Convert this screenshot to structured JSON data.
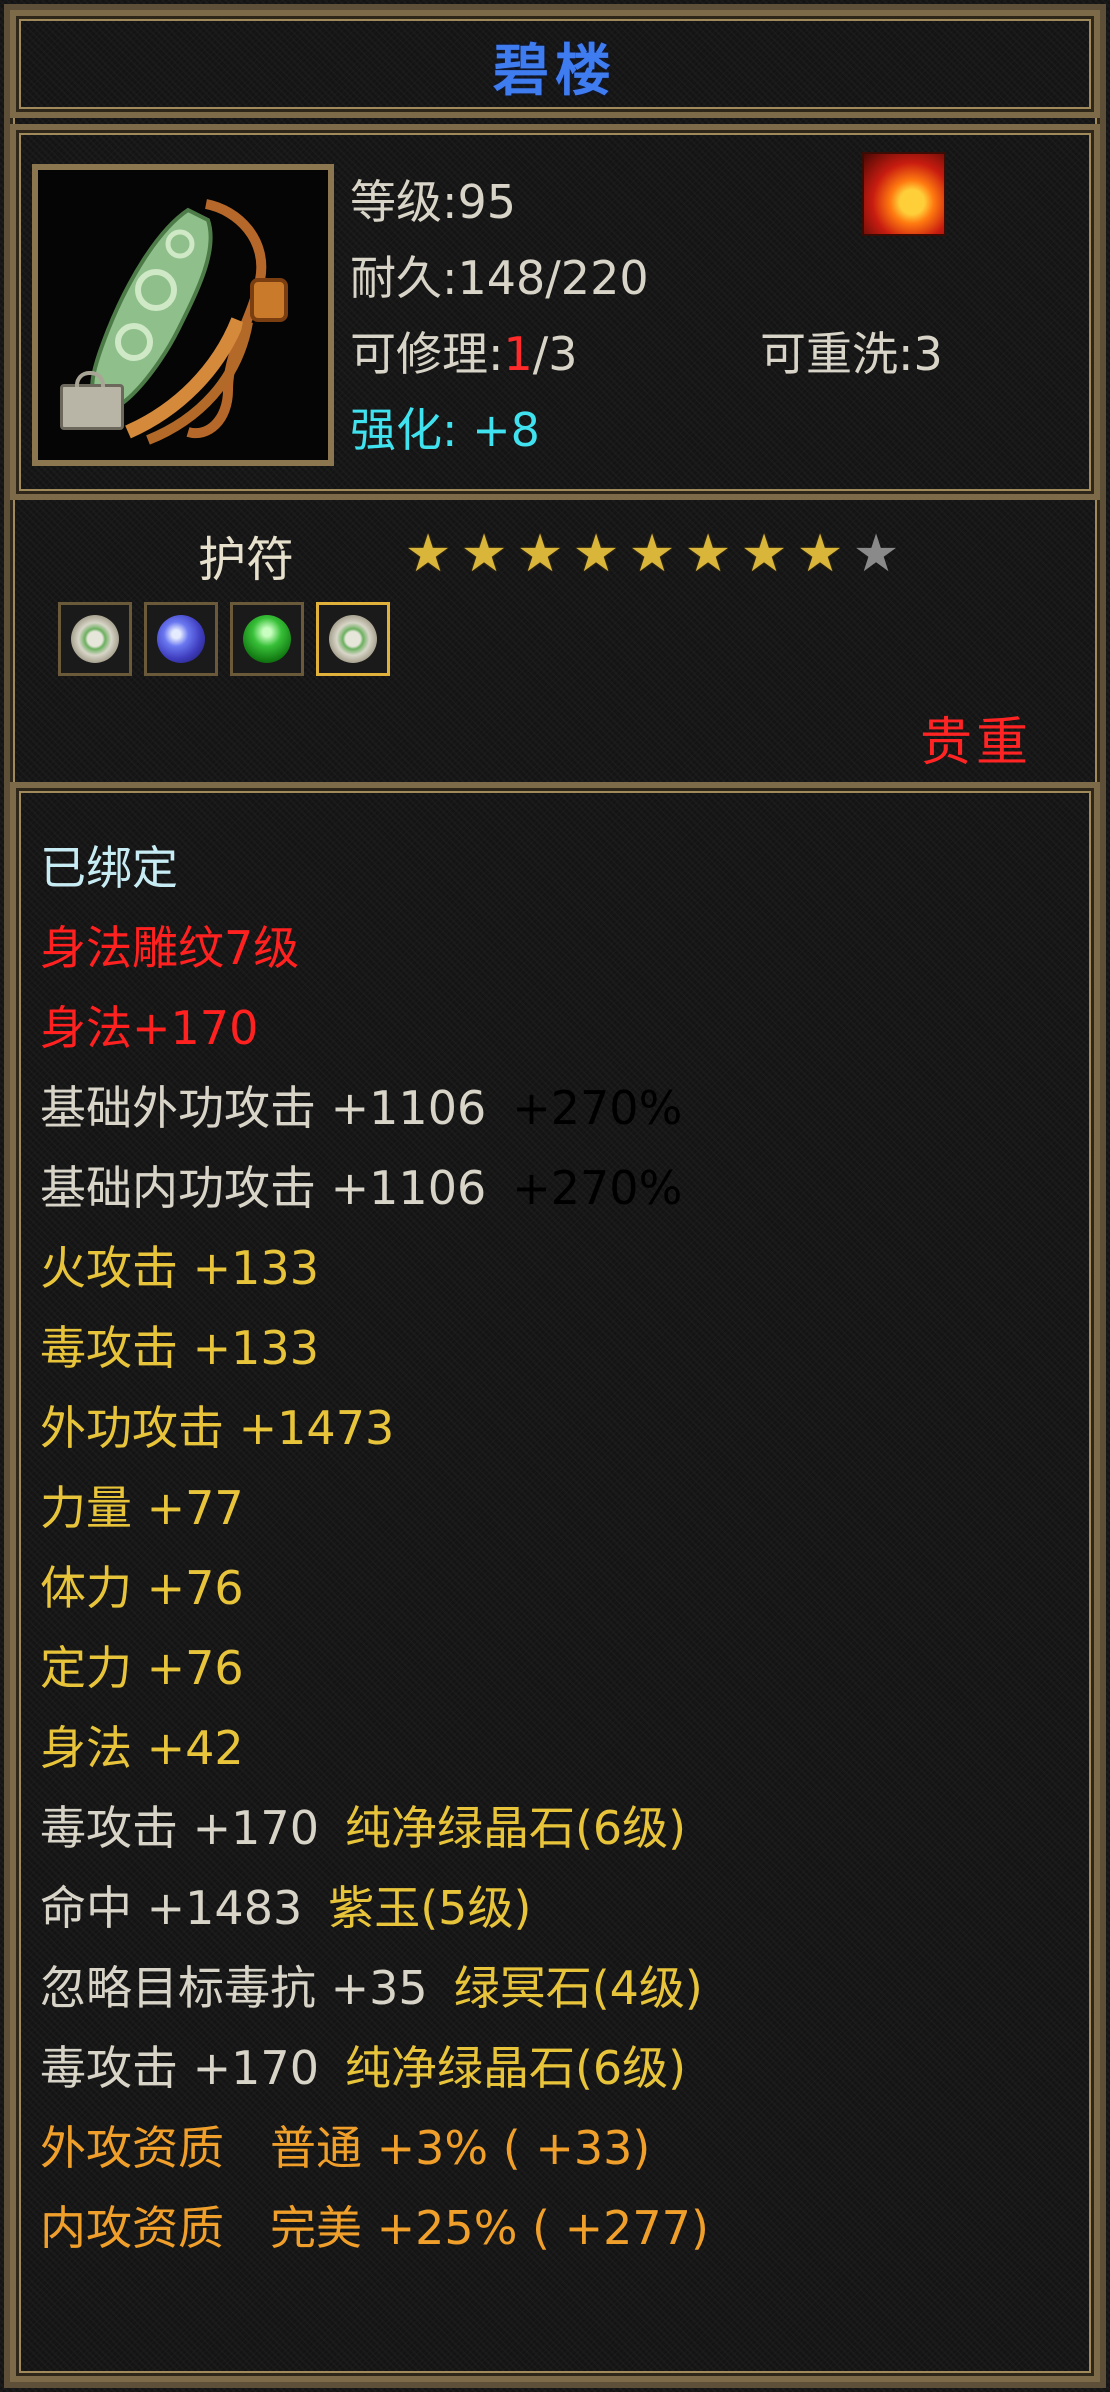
{
  "item": {
    "name": "碧楼",
    "level_label": "等级:95",
    "durability_label": "耐久:148/220",
    "repair_prefix": "可修理:",
    "repair_current": "1",
    "repair_suffix": "/3",
    "rewash_label": "可重洗:3",
    "enhance_label": "强化:",
    "enhance_value": "+8"
  },
  "amulet": {
    "label": "护符",
    "stars_total": 9,
    "stars_filled": 8,
    "gems": [
      "ring-gem",
      "blue-gem",
      "green-gem",
      "ring-gem"
    ],
    "rarity": "贵重"
  },
  "attributes": [
    {
      "text": "已绑定",
      "color": "bind"
    },
    {
      "text": "身法雕纹7级",
      "color": "red"
    },
    {
      "text": "身法+170",
      "color": "red"
    },
    {
      "text": "基础外功攻击 +1106",
      "extra": "+270%",
      "color": "white",
      "extra_color": "cyan"
    },
    {
      "text": "基础内功攻击 +1106",
      "extra": "+270%",
      "color": "white",
      "extra_color": "cyan"
    },
    {
      "text": "火攻击 +133",
      "color": "yellow"
    },
    {
      "text": "毒攻击 +133",
      "color": "yellow"
    },
    {
      "text": "外功攻击 +1473",
      "color": "yellow"
    },
    {
      "text": "力量 +77",
      "color": "yellow"
    },
    {
      "text": "体力 +76",
      "color": "yellow"
    },
    {
      "text": "定力 +76",
      "color": "yellow"
    },
    {
      "text": "身法 +42",
      "color": "yellow"
    },
    {
      "text": "毒攻击 +170",
      "extra": "纯净绿晶石(6级)",
      "color": "white",
      "extra_color": "yellow"
    },
    {
      "text": "命中 +1483",
      "extra": "紫玉(5级)",
      "color": "white",
      "extra_color": "yellow"
    },
    {
      "text": "忽略目标毒抗 +35",
      "extra": "绿冥石(4级)",
      "color": "white",
      "extra_color": "yellow"
    },
    {
      "text": "毒攻击 +170",
      "extra": "纯净绿晶石(6级)",
      "color": "white",
      "extra_color": "yellow"
    },
    {
      "text": "外攻资质　普通 +3% ( +33)",
      "color": "orange"
    },
    {
      "text": "内攻资质　完美 +25% ( +277)",
      "color": "orange"
    }
  ],
  "colors": {
    "title": "#3f7cf0",
    "white": "#d8d4c8",
    "red": "#ff2020",
    "yellow": "#e8c43a",
    "orange": "#f0a02a",
    "cyan": "#3fe2ee",
    "bind": "#c8ecf4",
    "star_on": "#d9b53a",
    "star_off": "#8a8a8a"
  },
  "icons": {
    "item": "jade-pendant-icon",
    "lock": "lock-icon",
    "element": "fire-element-icon"
  }
}
